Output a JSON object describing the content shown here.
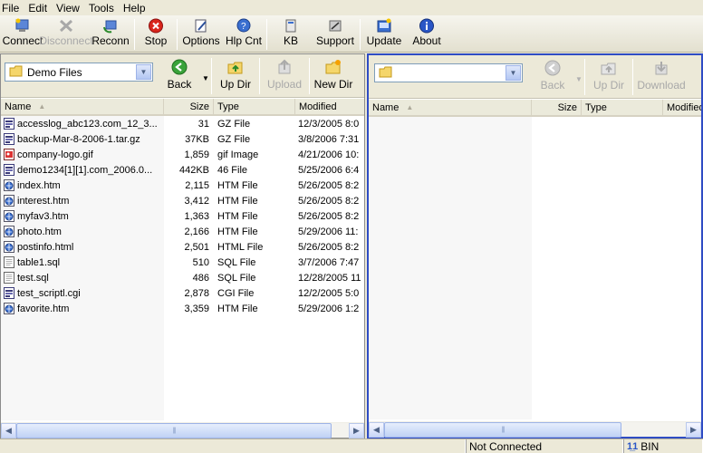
{
  "menu": [
    "File",
    "Edit",
    "View",
    "Tools",
    "Help"
  ],
  "toolbar": [
    {
      "label": "Connect",
      "icon": "connect-icon",
      "enabled": true
    },
    {
      "label": "Disconnect",
      "icon": "disconnect-icon",
      "enabled": false
    },
    {
      "label": "Reconn",
      "icon": "reconnect-icon",
      "enabled": true
    },
    {
      "label": "Stop",
      "icon": "stop-icon",
      "enabled": true
    },
    {
      "label": "Options",
      "icon": "options-icon",
      "enabled": true
    },
    {
      "label": "Hlp Cnt",
      "icon": "help-contents-icon",
      "enabled": true
    },
    {
      "label": "KB",
      "icon": "knowledge-base-icon",
      "enabled": true
    },
    {
      "label": "Support",
      "icon": "support-icon",
      "enabled": true
    },
    {
      "label": "Update",
      "icon": "update-icon",
      "enabled": true
    },
    {
      "label": "About",
      "icon": "about-icon",
      "enabled": true
    }
  ],
  "left_pane": {
    "folder": "Demo Files",
    "buttons": {
      "back": "Back",
      "updir": "Up Dir",
      "upload": "Upload",
      "newdir": "New Dir"
    },
    "columns": {
      "name": "Name",
      "size": "Size",
      "type": "Type",
      "modified": "Modified"
    },
    "files": [
      {
        "name": "accesslog_abc123.com_12_3...",
        "size": "31",
        "type": "GZ File",
        "modified": "12/3/2005 8:0",
        "icon": "archive"
      },
      {
        "name": "backup-Mar-8-2006-1.tar.gz",
        "size": "37KB",
        "type": "GZ File",
        "modified": "3/8/2006 7:31",
        "icon": "archive"
      },
      {
        "name": "company-logo.gif",
        "size": "1,859",
        "type": "gif Image",
        "modified": "4/21/2006 10:",
        "icon": "image"
      },
      {
        "name": "demo1234[1][1].com_2006.0...",
        "size": "442KB",
        "type": "46 File",
        "modified": "5/25/2006 6:4",
        "icon": "archive"
      },
      {
        "name": "index.htm",
        "size": "2,115",
        "type": "HTM File",
        "modified": "5/26/2005 8:2",
        "icon": "html"
      },
      {
        "name": "interest.htm",
        "size": "3,412",
        "type": "HTM File",
        "modified": "5/26/2005 8:2",
        "icon": "html"
      },
      {
        "name": "myfav3.htm",
        "size": "1,363",
        "type": "HTM File",
        "modified": "5/26/2005 8:2",
        "icon": "html"
      },
      {
        "name": "photo.htm",
        "size": "2,166",
        "type": "HTM File",
        "modified": "5/29/2006 11:",
        "icon": "html"
      },
      {
        "name": "postinfo.html",
        "size": "2,501",
        "type": "HTML File",
        "modified": "5/26/2005 8:2",
        "icon": "html"
      },
      {
        "name": "table1.sql",
        "size": "510",
        "type": "SQL File",
        "modified": "3/7/2006 7:47",
        "icon": "text"
      },
      {
        "name": "test.sql",
        "size": "486",
        "type": "SQL File",
        "modified": "12/28/2005 11",
        "icon": "text"
      },
      {
        "name": "test_scriptl.cgi",
        "size": "2,878",
        "type": "CGI File",
        "modified": "12/2/2005 5:0",
        "icon": "archive"
      },
      {
        "name": "favorite.htm",
        "size": "3,359",
        "type": "HTM File",
        "modified": "5/29/2006 1:2",
        "icon": "html"
      }
    ]
  },
  "right_pane": {
    "folder": "",
    "buttons": {
      "back": "Back",
      "updir": "Up Dir",
      "download": "Download"
    },
    "columns": {
      "name": "Name",
      "size": "Size",
      "type": "Type",
      "modified": "Modified"
    }
  },
  "status": {
    "connection": "Not Connected",
    "mode": "BIN"
  }
}
